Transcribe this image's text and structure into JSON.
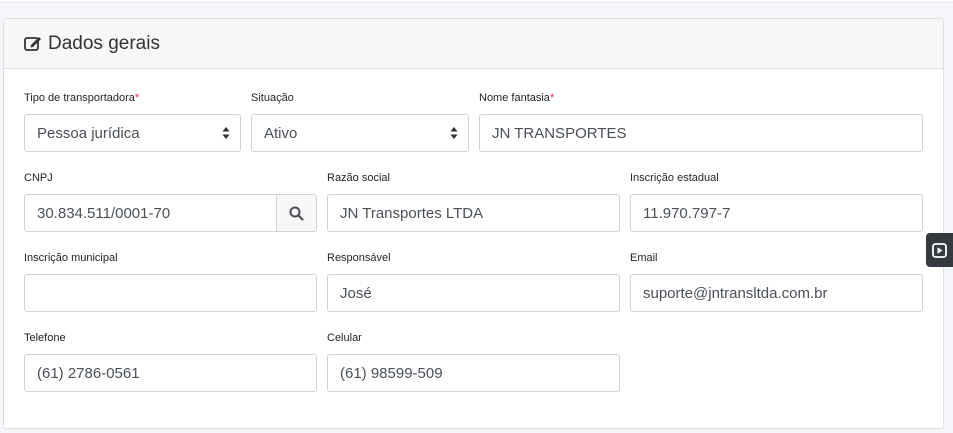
{
  "card": {
    "title": "Dados gerais",
    "icon": "edit-icon"
  },
  "fields": {
    "tipo_transportadora": {
      "label": "Tipo de transportadora",
      "required_mark": "*",
      "value": "Pessoa jurídica"
    },
    "situacao": {
      "label": "Situação",
      "value": "Ativo"
    },
    "nome_fantasia": {
      "label": "Nome fantasia",
      "required_mark": "*",
      "value": "JN TRANSPORTES"
    },
    "cnpj": {
      "label": "CNPJ",
      "value": "30.834.511/0001-70",
      "addon_icon": "search-icon"
    },
    "razao_social": {
      "label": "Razão social",
      "value": "JN Transportes LTDA"
    },
    "inscricao_estadual": {
      "label": "Inscrição estadual",
      "value": "11.970.797-7"
    },
    "inscricao_municipal": {
      "label": "Inscrição municipal",
      "value": ""
    },
    "responsavel": {
      "label": "Responsável",
      "value": "José"
    },
    "email": {
      "label": "Email",
      "value": "suporte@jntransltda.com.br"
    },
    "telefone": {
      "label": "Telefone",
      "value": "(61) 2786-0561"
    },
    "celular": {
      "label": "Celular",
      "value": "(61) 98599-509"
    }
  },
  "side_tab": {
    "icon": "play-square-icon"
  },
  "colors": {
    "required": "#dc3545",
    "border": "#ced4da",
    "header_bg": "#f7f7f7",
    "side_tab_bg": "#343a40"
  }
}
